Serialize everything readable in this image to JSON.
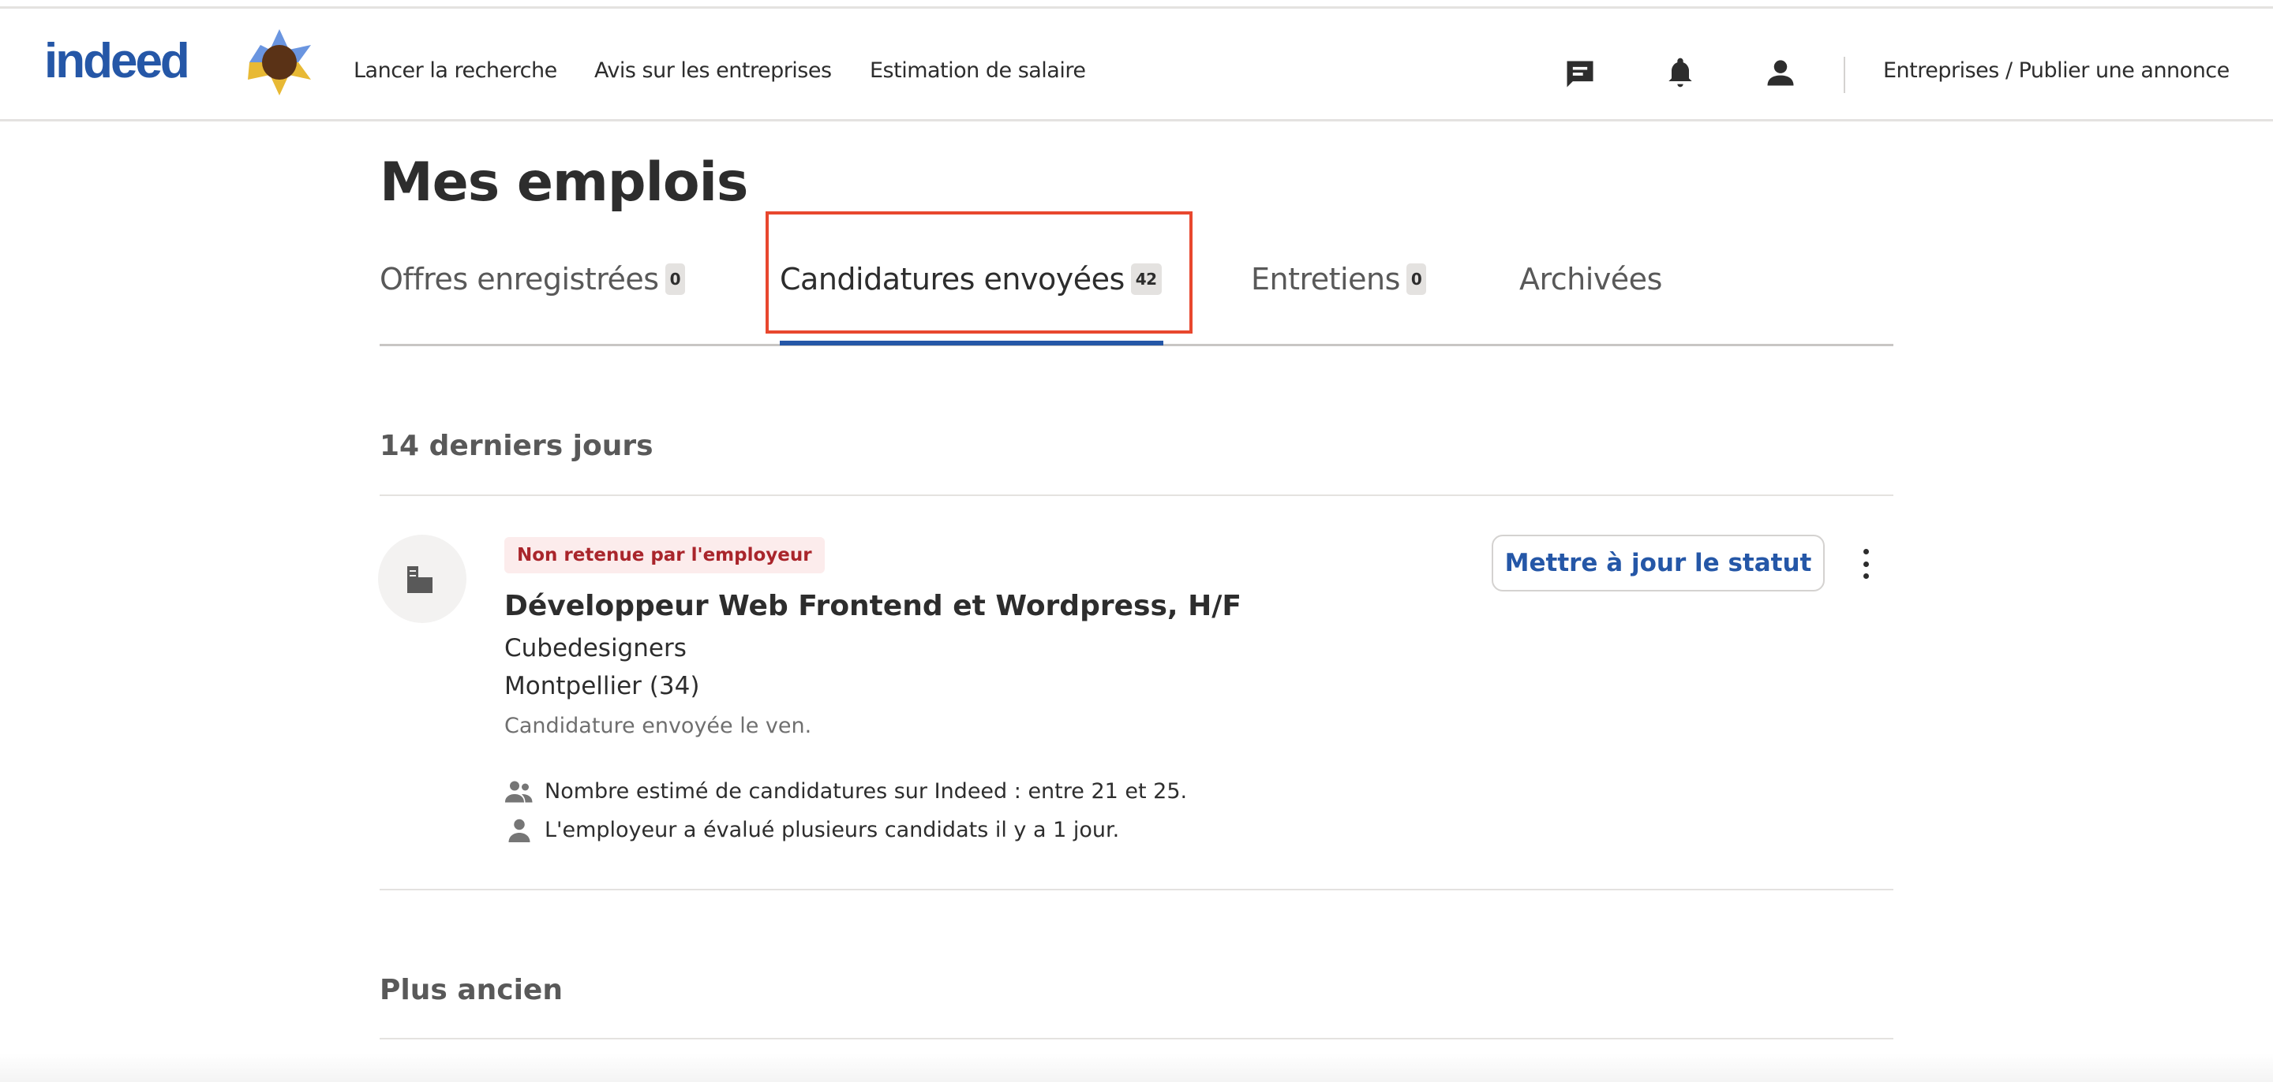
{
  "header": {
    "logo": "indeed",
    "nav": [
      "Lancer la recherche",
      "Avis sur les entreprises",
      "Estimation de salaire"
    ],
    "icons": [
      "messages-icon",
      "notifications-bell-icon",
      "account-user-icon"
    ],
    "employers_link": "Entreprises / Publier une annonce"
  },
  "page_title": "Mes emplois",
  "tabs": [
    {
      "label": "Offres enregistrées",
      "count": "0"
    },
    {
      "label": "Candidatures envoyées",
      "count": "42",
      "active": true
    },
    {
      "label": "Entretiens",
      "count": "0"
    },
    {
      "label": "Archivées"
    }
  ],
  "sections": {
    "recent": "14 derniers jours",
    "older": "Plus ancien"
  },
  "job": {
    "status": "Non retenue par l'employeur",
    "title": "Développeur Web Frontend et Wordpress, H/F",
    "company": "Cubedesigners",
    "location": "Montpellier (34)",
    "sent": "Candidature envoyée le ven.",
    "info": [
      "Nombre estimé de candidatures sur Indeed : entre 21 et 25.",
      "L'employeur a évalué plusieurs candidats il y a 1 jour."
    ],
    "update_button": "Mettre à jour le statut"
  },
  "colors": {
    "brand": "#2557a7",
    "highlight": "#e8472e",
    "status": "#a9252b"
  }
}
